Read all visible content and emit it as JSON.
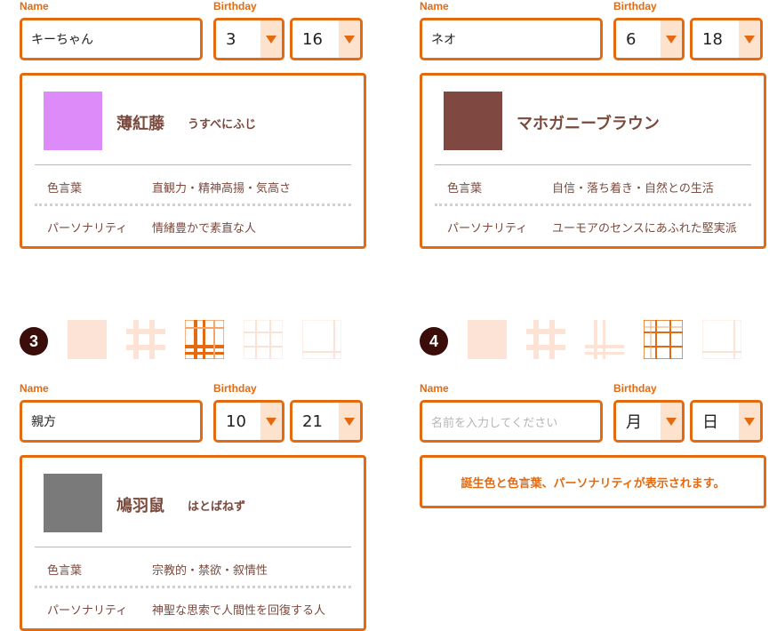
{
  "labels": {
    "name": "Name",
    "birthday": "Birthday"
  },
  "entries": [
    {
      "name": "キーちゃん",
      "month": "3",
      "day": "16",
      "color": {
        "name": "薄紅藤",
        "reading": "うすべにふじ",
        "hex": "#dc8bf8"
      },
      "kotoba_label": "色言葉",
      "kotoba": "直観力・精神高揚・気高さ",
      "personality_label": "パーソナリティ",
      "personality": "情緒豊かで素直な人"
    },
    {
      "name": "ネオ",
      "month": "6",
      "day": "18",
      "color": {
        "name": "マホガニーブラウン",
        "reading": "",
        "hex": "#7f4841"
      },
      "kotoba_label": "色言葉",
      "kotoba": "自信・落ち着き・自然との生活",
      "personality_label": "パーソナリティ",
      "personality": "ユーモアのセンスにあふれた堅実派"
    },
    {
      "number": "3",
      "name": "親方",
      "month": "10",
      "day": "21",
      "color": {
        "name": "鳩羽鼠",
        "reading": "はとばねず",
        "hex": "#7a7a7a"
      },
      "kotoba_label": "色言葉",
      "kotoba": "宗教的・禁欲・叙情性",
      "personality_label": "パーソナリティ",
      "personality": "神聖な思索で人間性を回復する人"
    },
    {
      "number": "4",
      "name_placeholder": "名前を入力してください",
      "month": "月",
      "day": "日",
      "message": "誕生色と色言葉、パーソナリティが表示されます。"
    }
  ],
  "pattern_icons": [
    "solid-pattern",
    "light-plaid-pattern",
    "bold-plaid-pattern",
    "thin-grid-pattern",
    "corner-lines-pattern"
  ],
  "selected_patterns": {
    "row3": 2,
    "row4": 3
  },
  "colors": {
    "accent": "#e36a10",
    "text_brown": "#7a4a3e",
    "arrow_bg": "#fde3cd",
    "number_badge": "#3a0d0a"
  }
}
